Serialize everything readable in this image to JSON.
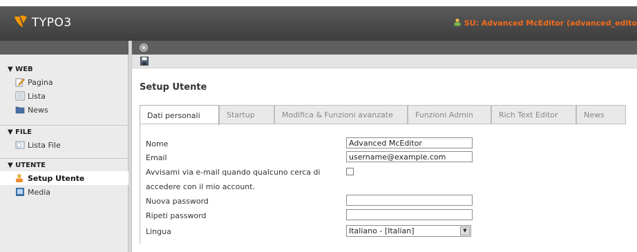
{
  "header": {
    "logo_text": "TYPO3",
    "su_label": "SU: Advanced McEditor (advanced_edito"
  },
  "sidebar": {
    "sections": [
      {
        "title": "▼ WEB",
        "items": [
          {
            "label": "Pagina",
            "icon": "page-pencil-icon"
          },
          {
            "label": "Lista",
            "icon": "list-icon"
          },
          {
            "label": "News",
            "icon": "folder-icon"
          }
        ]
      },
      {
        "title": "▼ FILE",
        "items": [
          {
            "label": "Lista File",
            "icon": "file-list-icon"
          }
        ]
      },
      {
        "title": "▼ UTENTE",
        "items": [
          {
            "label": "Setup Utente",
            "icon": "user-setup-icon",
            "active": true
          },
          {
            "label": "Media",
            "icon": "media-icon"
          }
        ]
      }
    ]
  },
  "main": {
    "title": "Setup Utente",
    "tabs": [
      {
        "label": "Dati personali",
        "active": true
      },
      {
        "label": "Startup"
      },
      {
        "label": "Modifica & Funzioni avanzate"
      },
      {
        "label": "Funzioni Admin"
      },
      {
        "label": "Rich Text Editor"
      },
      {
        "label": "News"
      }
    ],
    "form": {
      "nome_label": "Nome",
      "nome_value": "Advanced McEditor",
      "email_label": "Email",
      "email_value": "username@example.com",
      "notify_label_line1": "Avvisami via e-mail quando qualcuno cerca di",
      "notify_label_line2": "accedere con il mio account.",
      "notify_checked": false,
      "password_label": "Nuova password",
      "password_value": "",
      "repeat_label": "Ripeti password",
      "repeat_value": "",
      "lingua_label": "Lingua",
      "lingua_value": "Italiano - [Italian]"
    }
  },
  "colors": {
    "topbar": "#4a4a4a",
    "su_text": "#f26b1d",
    "logo_orange": "#f49700"
  }
}
